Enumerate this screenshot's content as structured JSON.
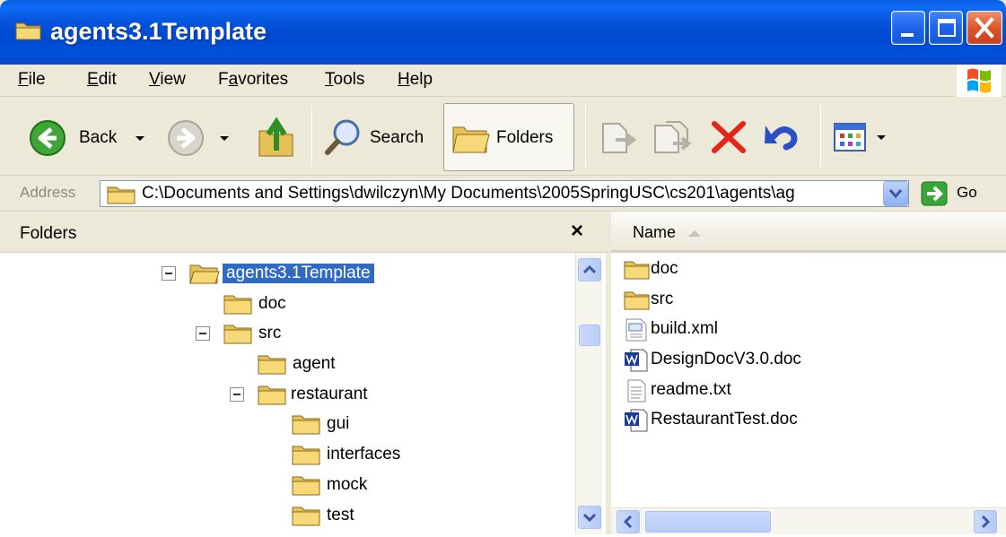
{
  "window": {
    "title": "agents3.1Template"
  },
  "menu": [
    {
      "label": "File",
      "accel": "F",
      "rest": "ile"
    },
    {
      "label": "Edit",
      "accel": "E",
      "rest": "dit"
    },
    {
      "label": "View",
      "accel": "V",
      "rest": "iew"
    },
    {
      "label": "Favorites",
      "pre": "F",
      "accel": "a",
      "rest": "vorites"
    },
    {
      "label": "Tools",
      "accel": "T",
      "rest": "ools"
    },
    {
      "label": "Help",
      "accel": "H",
      "rest": "elp"
    }
  ],
  "toolbar": {
    "back_label": "Back",
    "search_label": "Search",
    "folders_label": "Folders"
  },
  "address": {
    "label": "Address",
    "value": "C:\\Documents and Settings\\dwilczyn\\My Documents\\2005SpringUSC\\cs201\\agents\\ag",
    "go_label": "Go"
  },
  "folders_pane": {
    "title": "Folders",
    "close_glyph": "×",
    "tree": [
      {
        "label": "agents3.1Template",
        "selected": true,
        "expanded": true
      },
      {
        "label": "doc"
      },
      {
        "label": "src",
        "expanded": true
      },
      {
        "label": "agent"
      },
      {
        "label": "restaurant",
        "expanded": true
      },
      {
        "label": "gui"
      },
      {
        "label": "interfaces"
      },
      {
        "label": "mock"
      },
      {
        "label": "test"
      }
    ]
  },
  "files_pane": {
    "column_name": "Name",
    "files": [
      {
        "name": "doc",
        "icon": "folder-icon"
      },
      {
        "name": "src",
        "icon": "folder-icon"
      },
      {
        "name": "build.xml",
        "icon": "xml-file-icon"
      },
      {
        "name": "DesignDocV3.0.doc",
        "icon": "word-doc-icon"
      },
      {
        "name": "readme.txt",
        "icon": "text-file-icon"
      },
      {
        "name": "RestaurantTest.doc",
        "icon": "word-doc-icon"
      }
    ]
  },
  "colors": {
    "titlebar": "#0553d9",
    "selection": "#316ac5",
    "chrome": "#ece9d8"
  }
}
